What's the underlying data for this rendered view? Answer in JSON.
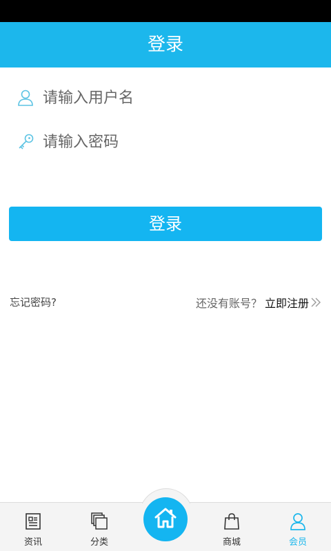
{
  "header": {
    "title": "登录"
  },
  "form": {
    "username_placeholder": "请输入用户名",
    "password_placeholder": "请输入密码",
    "login_label": "登录"
  },
  "links": {
    "forgot": "忘记密码?",
    "no_account": "还没有账号？",
    "register": "立即注册"
  },
  "tabbar": {
    "items": [
      {
        "label": "资讯",
        "icon": "news-icon"
      },
      {
        "label": "分类",
        "icon": "category-icon"
      },
      {
        "label": "",
        "icon": "home-icon"
      },
      {
        "label": "商城",
        "icon": "shopping-bag-icon"
      },
      {
        "label": "会员",
        "icon": "user-icon"
      }
    ],
    "active": "会员"
  },
  "colors": {
    "accent": "#14b5f1",
    "header": "#1cb7ec"
  }
}
